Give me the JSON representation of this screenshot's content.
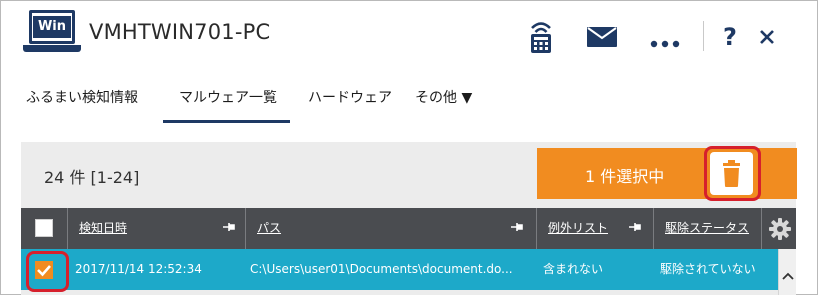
{
  "header": {
    "pc_badge": "Win",
    "pc_name": "VMHTWIN701-PC"
  },
  "tabs": [
    {
      "label": "ふるまい検知情報"
    },
    {
      "label": "マルウェア一覧"
    },
    {
      "label": "ハードウェア"
    },
    {
      "label": "その他 ▼"
    }
  ],
  "summary": {
    "count": "24 件  [1-24]",
    "selected_label": "1 件選択中"
  },
  "table": {
    "columns": [
      "検知日時",
      "パス",
      "例外リスト",
      "駆除ステータス"
    ],
    "rows": [
      {
        "datetime": "2017/11/14 12:52:34",
        "path": "C:\\Users\\user01\\Documents\\document.do...",
        "exception": "含まれない",
        "status": "駆除されていない",
        "checked": true
      }
    ]
  },
  "colors": {
    "navy": "#1e3964",
    "orange": "#f18c20",
    "row_highlight": "#1da9c9",
    "table_header": "#4a4c50",
    "highlight_ring": "#d6202c"
  },
  "icons": [
    "computer-win-icon",
    "wifi-phone-icon",
    "mail-icon",
    "more-icon",
    "help-icon",
    "close-icon",
    "trash-icon",
    "pin-icon",
    "settings-gear-icon",
    "check-icon",
    "chevron-up-icon"
  ]
}
